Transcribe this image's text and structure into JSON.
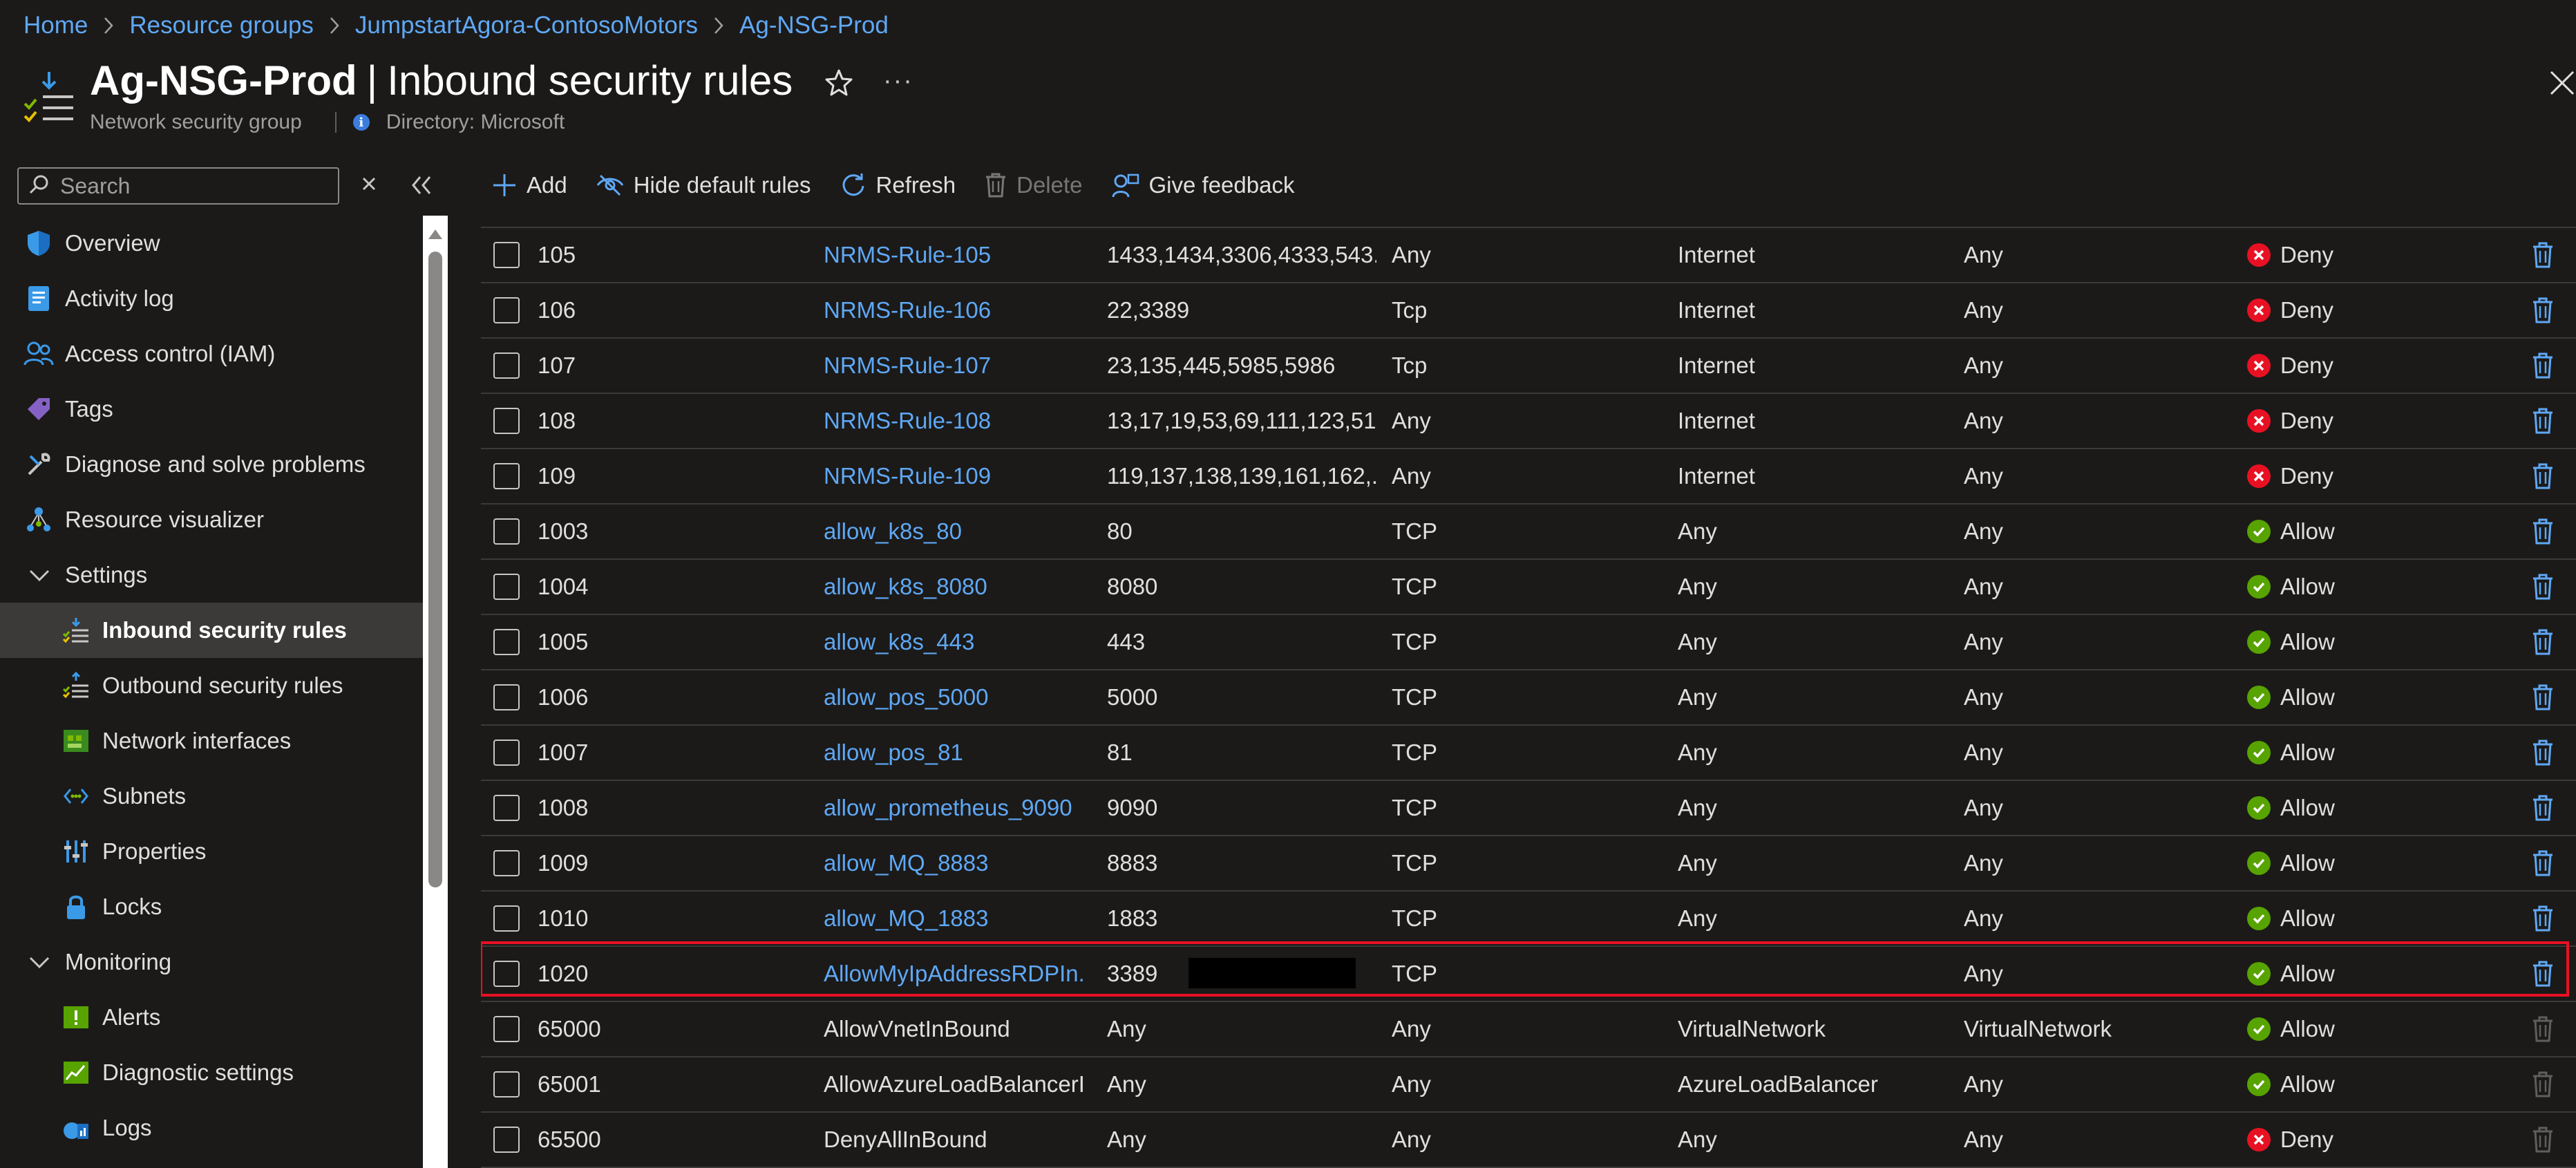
{
  "breadcrumb": [
    "Home",
    "Resource groups",
    "JumpstartAgora-ContosoMotors",
    "Ag-NSG-Prod"
  ],
  "header": {
    "resource_name": "Ag-NSG-Prod",
    "separator": "|",
    "blade_title": "Inbound security rules",
    "resource_type": "Network security group",
    "directory": "Directory: Microsoft",
    "more": "···"
  },
  "search": {
    "placeholder": "Search"
  },
  "sidebar": {
    "items": [
      {
        "label": "Overview",
        "icon": "shield-icon"
      },
      {
        "label": "Activity log",
        "icon": "activity-log-icon"
      },
      {
        "label": "Access control (IAM)",
        "icon": "people-icon"
      },
      {
        "label": "Tags",
        "icon": "tag-icon"
      },
      {
        "label": "Diagnose and solve problems",
        "icon": "wrench-icon"
      },
      {
        "label": "Resource visualizer",
        "icon": "visualizer-icon"
      },
      {
        "label": "Settings",
        "icon": "chevron-down-icon"
      },
      {
        "label": "Inbound security rules",
        "icon": "inbound-rules-icon"
      },
      {
        "label": "Outbound security rules",
        "icon": "outbound-rules-icon"
      },
      {
        "label": "Network interfaces",
        "icon": "network-interface-icon"
      },
      {
        "label": "Subnets",
        "icon": "subnet-icon"
      },
      {
        "label": "Properties",
        "icon": "properties-icon"
      },
      {
        "label": "Locks",
        "icon": "lock-icon"
      },
      {
        "label": "Monitoring",
        "icon": "chevron-down-icon"
      },
      {
        "label": "Alerts",
        "icon": "alert-icon"
      },
      {
        "label": "Diagnostic settings",
        "icon": "diagnostic-settings-icon"
      },
      {
        "label": "Logs",
        "icon": "logs-icon"
      }
    ]
  },
  "toolbar": {
    "add": "Add",
    "hide_default": "Hide default rules",
    "refresh": "Refresh",
    "delete": "Delete",
    "feedback": "Give feedback"
  },
  "rules": [
    {
      "priority": "105",
      "name": "NRMS-Rule-105",
      "port": "1433,1434,3306,4333,543...",
      "protocol": "Any",
      "source": "Internet",
      "destination": "Any",
      "action": "Deny",
      "link": true
    },
    {
      "priority": "106",
      "name": "NRMS-Rule-106",
      "port": "22,3389",
      "protocol": "Tcp",
      "source": "Internet",
      "destination": "Any",
      "action": "Deny",
      "link": true
    },
    {
      "priority": "107",
      "name": "NRMS-Rule-107",
      "port": "23,135,445,5985,5986",
      "protocol": "Tcp",
      "source": "Internet",
      "destination": "Any",
      "action": "Deny",
      "link": true
    },
    {
      "priority": "108",
      "name": "NRMS-Rule-108",
      "port": "13,17,19,53,69,111,123,51...",
      "protocol": "Any",
      "source": "Internet",
      "destination": "Any",
      "action": "Deny",
      "link": true
    },
    {
      "priority": "109",
      "name": "NRMS-Rule-109",
      "port": "119,137,138,139,161,162,...",
      "protocol": "Any",
      "source": "Internet",
      "destination": "Any",
      "action": "Deny",
      "link": true
    },
    {
      "priority": "1003",
      "name": "allow_k8s_80",
      "port": "80",
      "protocol": "TCP",
      "source": "Any",
      "destination": "Any",
      "action": "Allow",
      "link": true
    },
    {
      "priority": "1004",
      "name": "allow_k8s_8080",
      "port": "8080",
      "protocol": "TCP",
      "source": "Any",
      "destination": "Any",
      "action": "Allow",
      "link": true
    },
    {
      "priority": "1005",
      "name": "allow_k8s_443",
      "port": "443",
      "protocol": "TCP",
      "source": "Any",
      "destination": "Any",
      "action": "Allow",
      "link": true
    },
    {
      "priority": "1006",
      "name": "allow_pos_5000",
      "port": "5000",
      "protocol": "TCP",
      "source": "Any",
      "destination": "Any",
      "action": "Allow",
      "link": true
    },
    {
      "priority": "1007",
      "name": "allow_pos_81",
      "port": "81",
      "protocol": "TCP",
      "source": "Any",
      "destination": "Any",
      "action": "Allow",
      "link": true
    },
    {
      "priority": "1008",
      "name": "allow_prometheus_9090",
      "port": "9090",
      "protocol": "TCP",
      "source": "Any",
      "destination": "Any",
      "action": "Allow",
      "link": true
    },
    {
      "priority": "1009",
      "name": "allow_MQ_8883",
      "port": "8883",
      "protocol": "TCP",
      "source": "Any",
      "destination": "Any",
      "action": "Allow",
      "link": true
    },
    {
      "priority": "1010",
      "name": "allow_MQ_1883",
      "port": "1883",
      "protocol": "TCP",
      "source": "Any",
      "destination": "Any",
      "action": "Allow",
      "link": true
    },
    {
      "priority": "1020",
      "name": "AllowMyIpAddressRDPIn...",
      "port": "3389",
      "protocol": "TCP",
      "source": "",
      "destination": "Any",
      "action": "Allow",
      "link": true
    },
    {
      "priority": "65000",
      "name": "AllowVnetInBound",
      "port": "Any",
      "protocol": "Any",
      "source": "VirtualNetwork",
      "destination": "VirtualNetwork",
      "action": "Allow",
      "link": false
    },
    {
      "priority": "65001",
      "name": "AllowAzureLoadBalancerI...",
      "port": "Any",
      "protocol": "Any",
      "source": "AzureLoadBalancer",
      "destination": "Any",
      "action": "Allow",
      "link": false
    },
    {
      "priority": "65500",
      "name": "DenyAllInBound",
      "port": "Any",
      "protocol": "Any",
      "source": "Any",
      "destination": "Any",
      "action": "Deny",
      "link": false
    }
  ],
  "colors": {
    "accent": "#5fa8f5",
    "deny": "#e81123",
    "allow": "#57a300",
    "highlight": "#e81123"
  }
}
